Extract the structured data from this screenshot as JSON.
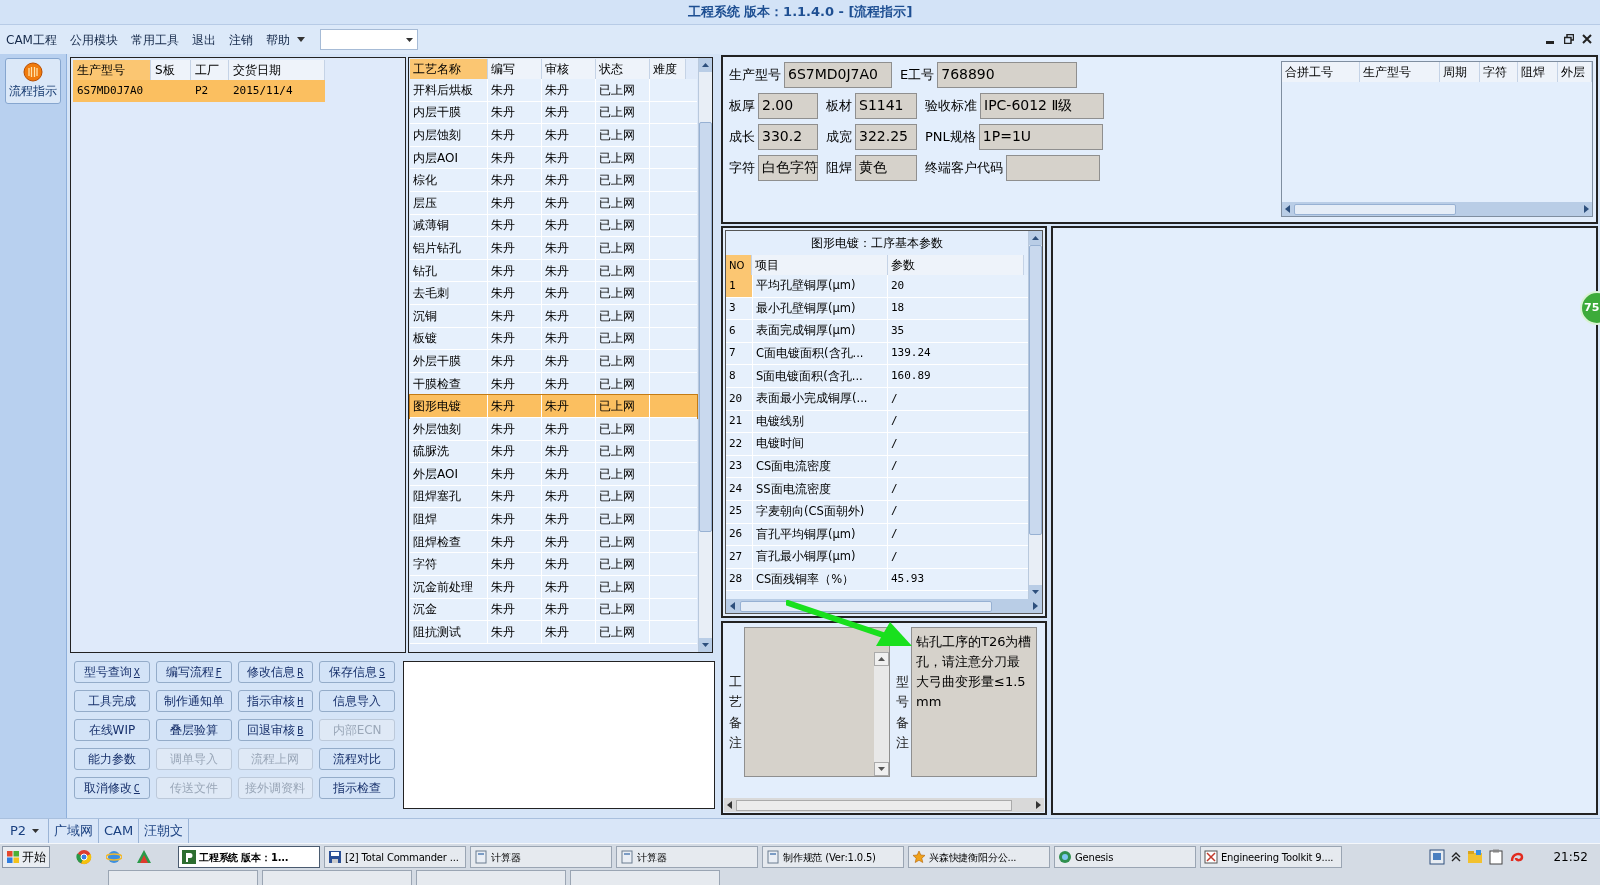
{
  "window": {
    "title": "工程系统  版本：1.1.4.0 - [流程指示]"
  },
  "menu": [
    {
      "label": "CAM工程"
    },
    {
      "label": "公用模块"
    },
    {
      "label": "常用工具"
    },
    {
      "label": "退出"
    },
    {
      "label": "注销"
    },
    {
      "label": "帮助"
    }
  ],
  "rail": {
    "button": "流程指示"
  },
  "orders": {
    "columns": [
      "生产型号",
      "S板",
      "工厂",
      "交货日期"
    ],
    "rows": [
      {
        "model": "6S7MD0J7A0",
        "factory": "P2",
        "date": "2015/11/4",
        "selected": true
      }
    ]
  },
  "processes": {
    "columns": [
      "工艺名称",
      "编写",
      "审核",
      "状态",
      "难度"
    ],
    "rows": [
      {
        "name": "开料后烘板",
        "writer": "朱丹",
        "reviewer": "朱丹",
        "status": "已上网",
        "selected": false
      },
      {
        "name": "内层干膜",
        "writer": "朱丹",
        "reviewer": "朱丹",
        "status": "已上网",
        "selected": false
      },
      {
        "name": "内层蚀刻",
        "writer": "朱丹",
        "reviewer": "朱丹",
        "status": "已上网",
        "selected": false
      },
      {
        "name": "内层AOI",
        "writer": "朱丹",
        "reviewer": "朱丹",
        "status": "已上网",
        "selected": false
      },
      {
        "name": "棕化",
        "writer": "朱丹",
        "reviewer": "朱丹",
        "status": "已上网",
        "selected": false
      },
      {
        "name": "层压",
        "writer": "朱丹",
        "reviewer": "朱丹",
        "status": "已上网",
        "selected": false
      },
      {
        "name": "减薄铜",
        "writer": "朱丹",
        "reviewer": "朱丹",
        "status": "已上网",
        "selected": false
      },
      {
        "name": "铝片钻孔",
        "writer": "朱丹",
        "reviewer": "朱丹",
        "status": "已上网",
        "selected": false
      },
      {
        "name": "钻孔",
        "writer": "朱丹",
        "reviewer": "朱丹",
        "status": "已上网",
        "selected": false
      },
      {
        "name": "去毛刺",
        "writer": "朱丹",
        "reviewer": "朱丹",
        "status": "已上网",
        "selected": false
      },
      {
        "name": "沉铜",
        "writer": "朱丹",
        "reviewer": "朱丹",
        "status": "已上网",
        "selected": false
      },
      {
        "name": "板镀",
        "writer": "朱丹",
        "reviewer": "朱丹",
        "status": "已上网",
        "selected": false
      },
      {
        "name": "外层干膜",
        "writer": "朱丹",
        "reviewer": "朱丹",
        "status": "已上网",
        "selected": false
      },
      {
        "name": "干膜检查",
        "writer": "朱丹",
        "reviewer": "朱丹",
        "status": "已上网",
        "selected": false
      },
      {
        "name": "图形电镀",
        "writer": "朱丹",
        "reviewer": "朱丹",
        "status": "已上网",
        "selected": true
      },
      {
        "name": "外层蚀刻",
        "writer": "朱丹",
        "reviewer": "朱丹",
        "status": "已上网",
        "selected": false
      },
      {
        "name": "硫脲洗",
        "writer": "朱丹",
        "reviewer": "朱丹",
        "status": "已上网",
        "selected": false
      },
      {
        "name": "外层AOI",
        "writer": "朱丹",
        "reviewer": "朱丹",
        "status": "已上网",
        "selected": false
      },
      {
        "name": "阻焊塞孔",
        "writer": "朱丹",
        "reviewer": "朱丹",
        "status": "已上网",
        "selected": false
      },
      {
        "name": "阻焊",
        "writer": "朱丹",
        "reviewer": "朱丹",
        "status": "已上网",
        "selected": false
      },
      {
        "name": "阻焊检查",
        "writer": "朱丹",
        "reviewer": "朱丹",
        "status": "已上网",
        "selected": false
      },
      {
        "name": "字符",
        "writer": "朱丹",
        "reviewer": "朱丹",
        "status": "已上网",
        "selected": false
      },
      {
        "name": "沉金前处理",
        "writer": "朱丹",
        "reviewer": "朱丹",
        "status": "已上网",
        "selected": false
      },
      {
        "name": "沉金",
        "writer": "朱丹",
        "reviewer": "朱丹",
        "status": "已上网",
        "selected": false
      },
      {
        "name": "阻抗测试",
        "writer": "朱丹",
        "reviewer": "朱丹",
        "status": "已上网",
        "selected": false
      }
    ]
  },
  "actions": [
    {
      "label": "型号查询",
      "hotkey": "X",
      "disabled": false
    },
    {
      "label": "编写流程",
      "hotkey": "F",
      "disabled": false
    },
    {
      "label": "修改信息",
      "hotkey": "R",
      "disabled": false
    },
    {
      "label": "保存信息",
      "hotkey": "S",
      "disabled": false
    },
    {
      "label": "工具完成",
      "disabled": false
    },
    {
      "label": "制作通知单",
      "disabled": false
    },
    {
      "label": "指示审核",
      "hotkey": "H",
      "disabled": false
    },
    {
      "label": "信息导入",
      "disabled": false
    },
    {
      "label": "在线WIP",
      "disabled": false
    },
    {
      "label": "叠层验算",
      "disabled": false
    },
    {
      "label": "回退审核",
      "hotkey": "B",
      "disabled": false
    },
    {
      "label": "内部ECN",
      "disabled": true
    },
    {
      "label": "能力参数",
      "disabled": false
    },
    {
      "label": "调单导入",
      "disabled": true
    },
    {
      "label": "流程上网",
      "disabled": true
    },
    {
      "label": "流程对比",
      "disabled": false
    },
    {
      "label": "取消修改",
      "hotkey": "C",
      "disabled": false
    },
    {
      "label": "传送文件",
      "disabled": true
    },
    {
      "label": "接外调资料",
      "disabled": true
    },
    {
      "label": "指示检查",
      "disabled": false
    }
  ],
  "info": {
    "fields": [
      {
        "label": "生产型号",
        "value": "6S7MD0J7A0"
      },
      {
        "label": "E工号",
        "value": "768890"
      },
      {
        "label": "板厚",
        "value": "2.00"
      },
      {
        "label": "板材",
        "value": "S1141"
      },
      {
        "label": "验收标准",
        "value": "IPC-6012 Ⅱ级"
      },
      {
        "label": "成长",
        "value": "330.2"
      },
      {
        "label": "成宽",
        "value": "322.25"
      },
      {
        "label": "PNL规格",
        "value": "1P=1U"
      },
      {
        "label": "字符",
        "value": "白色字符"
      },
      {
        "label": "阻焊",
        "value": "黄色"
      },
      {
        "label": "终端客户代码"
      }
    ],
    "merge_table": {
      "columns": [
        "合拼工号",
        "生产型号",
        "周期",
        "字符",
        "阻焊",
        "外层"
      ]
    }
  },
  "params": {
    "title": "图形电镀：工序基本参数",
    "columns": [
      "NO",
      "项目",
      "参数"
    ],
    "rows": [
      {
        "no": "1",
        "item": "平均孔壁铜厚(μm)",
        "value": "20",
        "selected": true
      },
      {
        "no": "3",
        "item": "最小孔壁铜厚(μm)",
        "value": "18",
        "selected": false
      },
      {
        "no": "6",
        "item": "表面完成铜厚(μm)",
        "value": "35",
        "selected": false
      },
      {
        "no": "7",
        "item": "C面电镀面积(含孔...",
        "value": "139.24",
        "selected": false
      },
      {
        "no": "8",
        "item": "S面电镀面积(含孔...",
        "value": "160.89",
        "selected": false
      },
      {
        "no": "20",
        "item": "表面最小完成铜厚(...",
        "value": "/",
        "selected": false
      },
      {
        "no": "21",
        "item": "电镀线别",
        "value": "/",
        "selected": false
      },
      {
        "no": "22",
        "item": "电镀时间",
        "value": "/",
        "selected": false
      },
      {
        "no": "23",
        "item": "CS面电流密度",
        "value": "/",
        "selected": false
      },
      {
        "no": "24",
        "item": "SS面电流密度",
        "value": "/",
        "selected": false
      },
      {
        "no": "25",
        "item": "字麦朝向(CS面朝外)",
        "value": "/",
        "selected": false
      },
      {
        "no": "26",
        "item": "盲孔平均铜厚(μm)",
        "value": "/",
        "selected": false
      },
      {
        "no": "27",
        "item": "盲孔最小铜厚(μm)",
        "value": "/",
        "selected": false
      },
      {
        "no": "28",
        "item": "CS面残铜率（%）",
        "value": "45.93",
        "selected": false
      }
    ]
  },
  "notes": {
    "process_label": "工艺备注",
    "model_label": "型号备注",
    "model_text": "钻孔工序的T26为槽孔，请注意分刀最大弓曲变形量≤1.5mm"
  },
  "side_badge": "75",
  "status_bar": {
    "factory": "P2",
    "items": [
      "广域网",
      "CAM",
      "汪朝文"
    ]
  },
  "taskbar": {
    "start": "开始",
    "tasks": [
      {
        "label": "工程系统  版本：1...",
        "active": true,
        "kind": "app"
      },
      {
        "label": "[2] Total Commander ...",
        "active": false,
        "kind": "disk"
      },
      {
        "label": "计算器",
        "active": false,
        "kind": "calc"
      },
      {
        "label": "计算器",
        "active": false,
        "kind": "calc"
      },
      {
        "label": "制作规范 (Ver:1.0.5)",
        "active": false,
        "kind": "calc"
      },
      {
        "label": "兴森快捷衡阳分公...",
        "active": false,
        "kind": "star"
      },
      {
        "label": "Genesis",
        "active": false,
        "kind": "globe"
      },
      {
        "label": "Engineering Toolkit 9....",
        "active": false,
        "kind": "window"
      }
    ],
    "clock": "21:52"
  }
}
